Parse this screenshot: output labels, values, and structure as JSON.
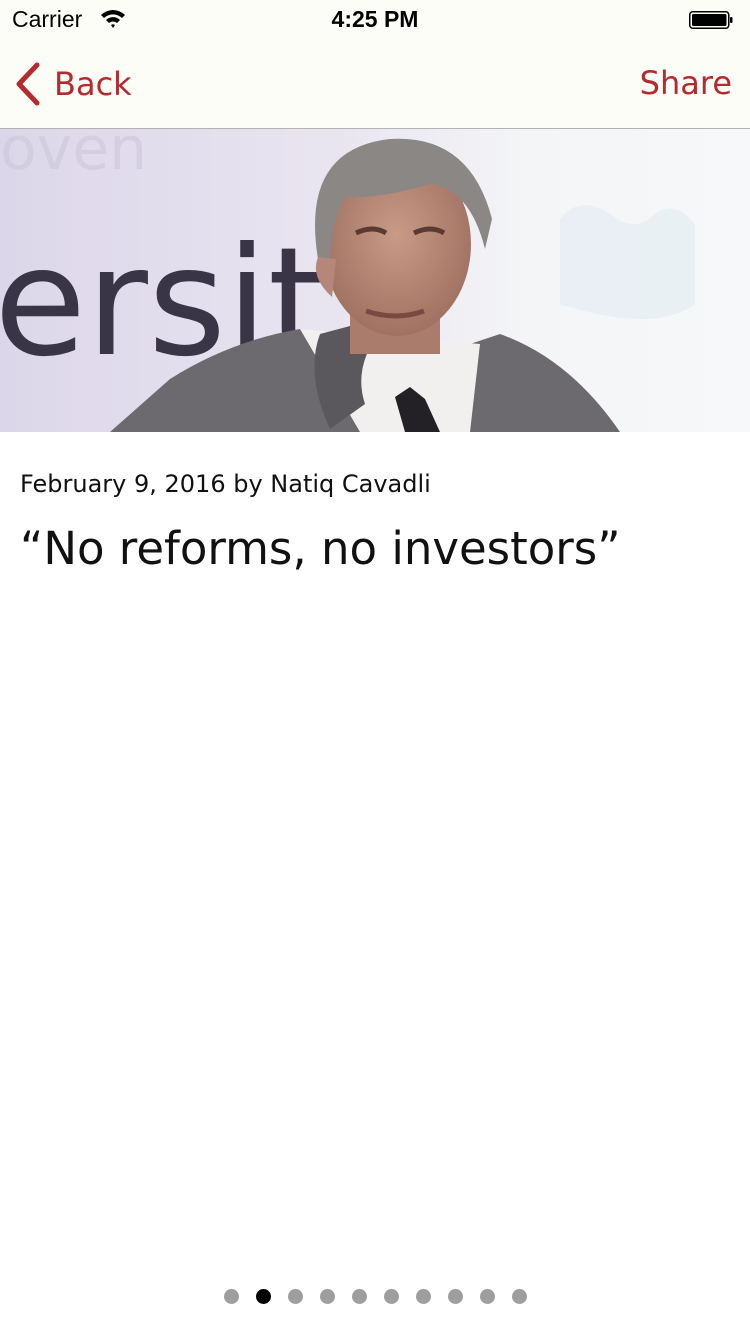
{
  "status_bar": {
    "carrier": "Carrier",
    "time": "4:25 PM",
    "icons": [
      "wifi-icon",
      "battery-icon"
    ]
  },
  "nav": {
    "back_label": "Back",
    "share_label": "Share",
    "back_icon": "chevron-left-icon",
    "tint_color": "#b32a2f",
    "bar_color": "#fdfdf8"
  },
  "article": {
    "meta": "February 9, 2016 by Natiq Cavadli",
    "title": "“No reforms, no investors”",
    "hero_sign_text": "ersit"
  },
  "pager": {
    "total": 10,
    "active_index": 1,
    "active_color": "#000000",
    "inactive_color": "#9e9e9e"
  }
}
